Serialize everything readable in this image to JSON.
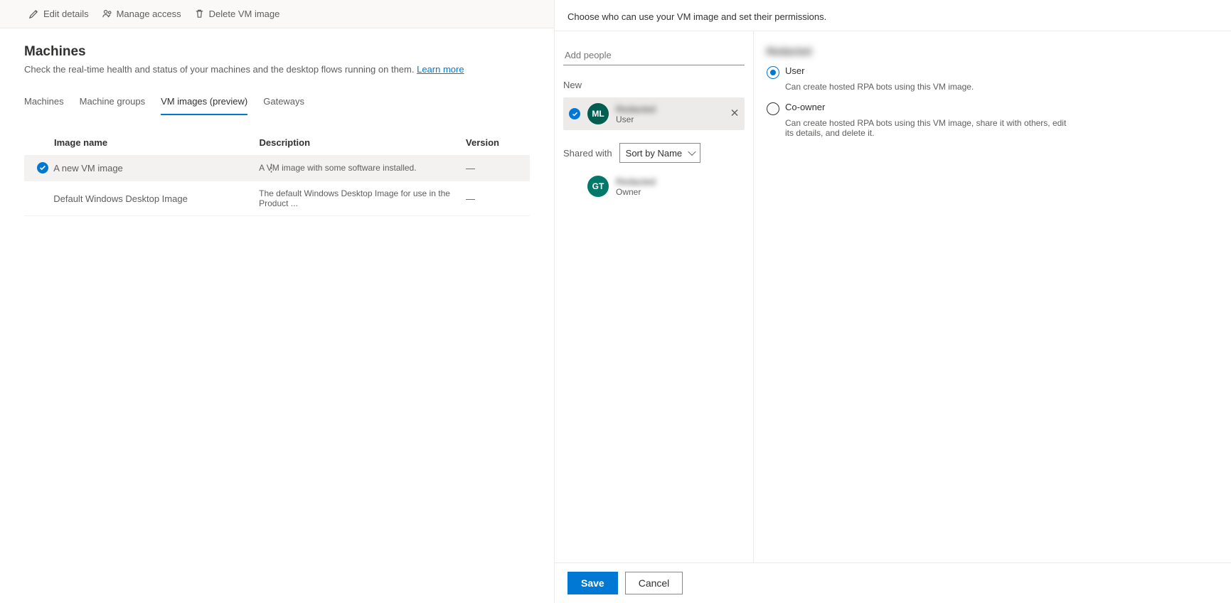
{
  "toolbar": {
    "edit_label": "Edit details",
    "access_label": "Manage access",
    "delete_label": "Delete VM image"
  },
  "page": {
    "title": "Machines",
    "desc_prefix": "Check the real-time health and status of your machines and the desktop flows running on them. ",
    "learn_more": "Learn more"
  },
  "tabs": [
    {
      "label": "Machines"
    },
    {
      "label": "Machine groups"
    },
    {
      "label": "VM images (preview)"
    },
    {
      "label": "Gateways"
    }
  ],
  "table": {
    "headers": {
      "name": "Image name",
      "desc": "Description",
      "version": "Version"
    },
    "rows": [
      {
        "selected": true,
        "name": "A new VM image",
        "desc": "A VM image with some software installed.",
        "version": "—"
      },
      {
        "selected": false,
        "name": "Default Windows Desktop Image",
        "desc": "The default Windows Desktop Image for use in the Product ...",
        "version": "—"
      }
    ]
  },
  "share_panel": {
    "description": "Choose who can use your VM image and set their permissions.",
    "add_people_placeholder": "Add people",
    "new_label": "New",
    "new_person": {
      "initials": "ML",
      "name": "Redacted",
      "role": "User"
    },
    "shared_with_label": "Shared with",
    "sort_value": "Sort by Name",
    "owner_person": {
      "initials": "GT",
      "name": "Redacted",
      "role": "Owner"
    },
    "selected_name": "Redacted",
    "permissions": [
      {
        "label": "User",
        "desc": "Can create hosted RPA bots using this VM image.",
        "checked": true
      },
      {
        "label": "Co-owner",
        "desc": "Can create hosted RPA bots using this VM image, share it with others, edit its details, and delete it.",
        "checked": false
      }
    ],
    "save_label": "Save",
    "cancel_label": "Cancel"
  }
}
